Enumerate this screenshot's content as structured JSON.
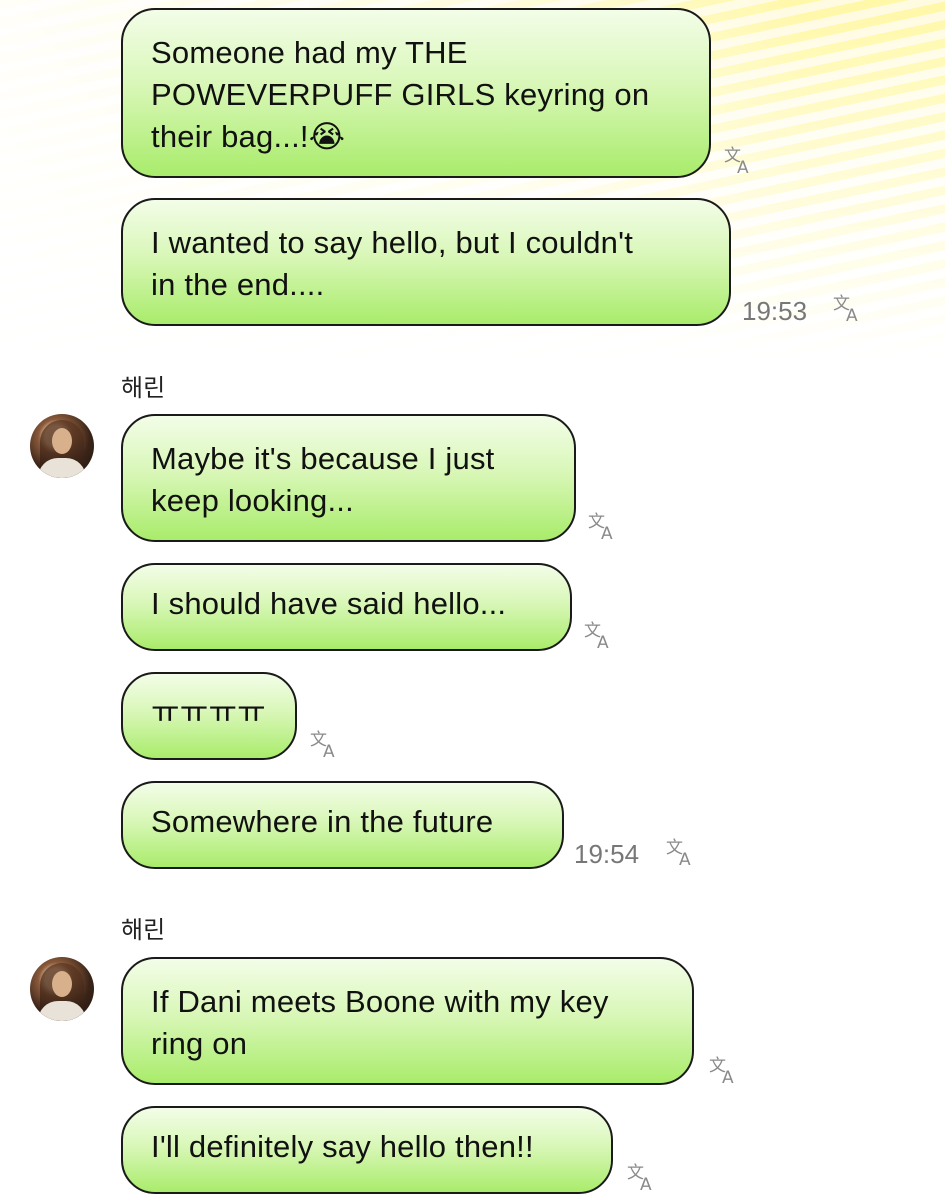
{
  "messages": [
    {
      "text": "Someone had my THE\nPOWEVERPUFF GIRLS keyring on\ntheir bag...!😭",
      "time": ""
    },
    {
      "text": "I wanted to say hello, but I couldn't\nin the end....",
      "time": "19:53"
    },
    {
      "text": "Maybe it's because I just\nkeep looking...",
      "time": ""
    },
    {
      "text": "I should have said hello...",
      "time": ""
    },
    {
      "text": "ㅠㅠㅠㅠ",
      "time": ""
    },
    {
      "text": "Somewhere in the future",
      "time": "19:54"
    },
    {
      "text": "If Dani meets Boone with my key\nring on",
      "time": ""
    },
    {
      "text": "I'll definitely say hello then!!",
      "time": ""
    }
  ],
  "senders": [
    "해린",
    "해린"
  ],
  "icons": {
    "translate": "translate-icon",
    "avatar": "avatar-photo"
  },
  "colors": {
    "bubble_top": "#f3fde8",
    "bubble_bottom": "#a9ec6b",
    "border": "#1a1a1a",
    "time": "#777777"
  }
}
